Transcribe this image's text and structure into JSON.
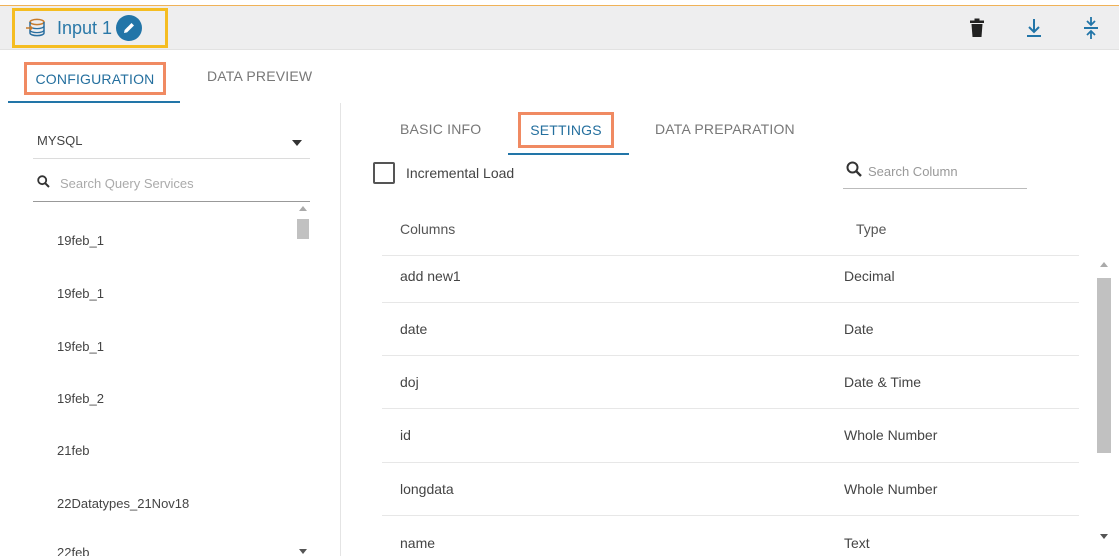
{
  "header": {
    "title": "Input 1",
    "icons": {
      "datasource": "database-icon",
      "edit": "pencil-icon",
      "delete": "trash-icon",
      "download": "download-icon",
      "collapse": "collapse-icon"
    }
  },
  "main_tabs": [
    {
      "label": "CONFIGURATION",
      "active": true
    },
    {
      "label": "DATA PREVIEW",
      "active": false
    }
  ],
  "left_panel": {
    "selected_source": "MYSQL",
    "search_placeholder": "Search Query Services",
    "items": [
      "19feb_1",
      "19feb_1",
      "19feb_1",
      "19feb_2",
      "21feb",
      "22Datatypes_21Nov18",
      "22feb"
    ]
  },
  "sub_tabs": [
    {
      "label": "BASIC INFO",
      "active": false
    },
    {
      "label": "SETTINGS",
      "active": true
    },
    {
      "label": "DATA PREPARATION",
      "active": false
    }
  ],
  "settings": {
    "incremental_load_label": "Incremental Load",
    "incremental_load_checked": false,
    "search_placeholder": "Search Column",
    "columns_header": "Columns",
    "type_header": "Type",
    "rows": [
      {
        "column": "add new1",
        "type": "Decimal"
      },
      {
        "column": "date",
        "type": "Date"
      },
      {
        "column": "doj",
        "type": "Date & Time"
      },
      {
        "column": "id",
        "type": "Whole Number"
      },
      {
        "column": "longdata",
        "type": "Whole Number"
      },
      {
        "column": "name",
        "type": "Text"
      }
    ]
  },
  "colors": {
    "accent_blue": "#2275a8",
    "highlight_yellow": "#f5bd22",
    "highlight_orange": "#f08a62"
  }
}
